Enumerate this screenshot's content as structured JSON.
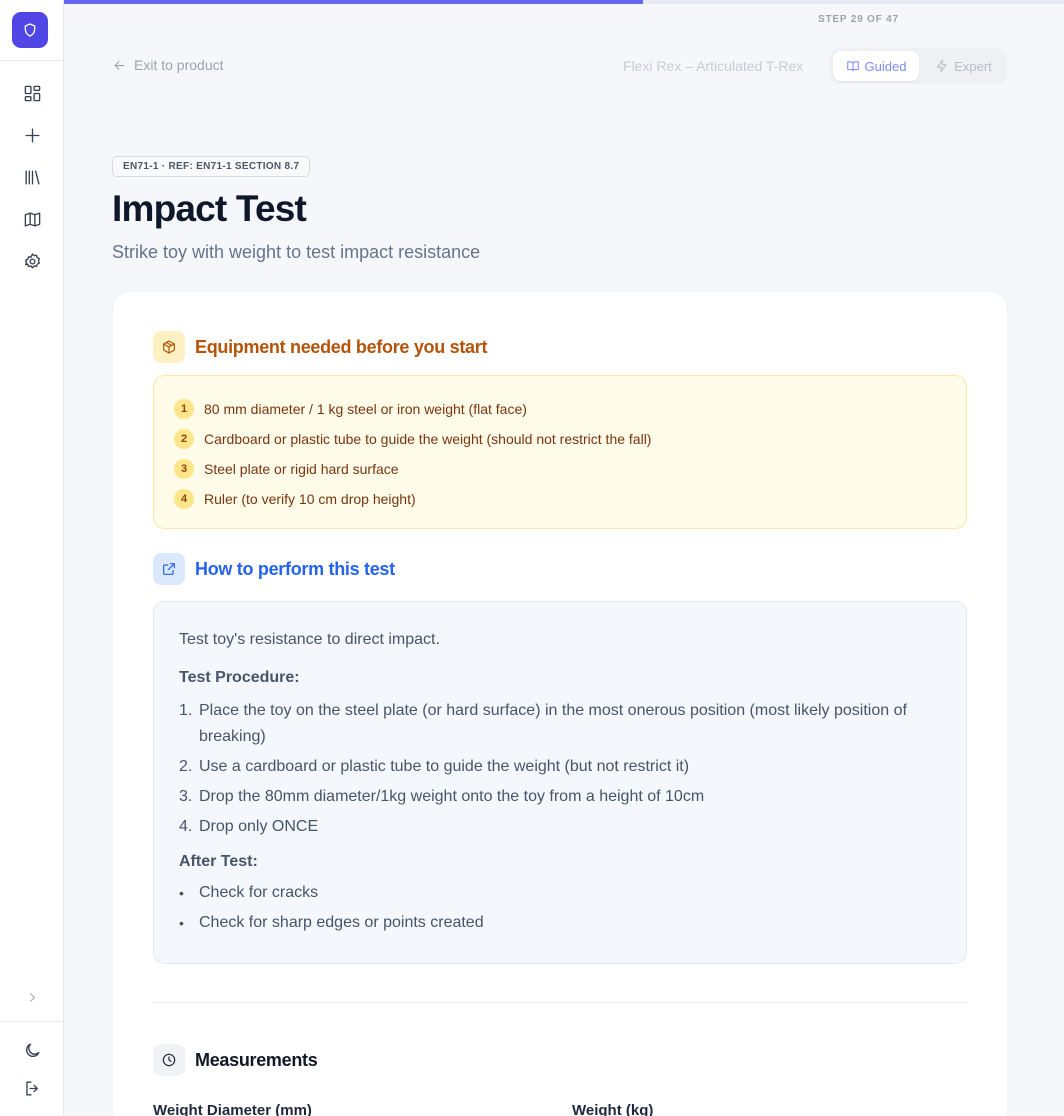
{
  "progress": {
    "current_step": 29,
    "total_steps": 47,
    "fraction": 0.604,
    "step_label": "STEP 29 OF 47",
    "color": "#6366f1"
  },
  "sidebar": {
    "logo_icon": "shield-icon",
    "items": [
      {
        "icon": "dashboard-icon"
      },
      {
        "icon": "plus-icon"
      },
      {
        "icon": "library-icon"
      },
      {
        "icon": "map-icon"
      },
      {
        "icon": "gear-icon"
      }
    ],
    "bottom": [
      {
        "icon": "chevron-right-icon"
      },
      {
        "icon": "moon-icon"
      },
      {
        "icon": "logout-icon"
      }
    ]
  },
  "header": {
    "exit_label": "Exit to product",
    "product_name": "Flexi Rex – Articulated T-Rex",
    "modes": [
      {
        "label": "Guided",
        "icon": "book-icon",
        "active": true
      },
      {
        "label": "Expert",
        "icon": "bolt-icon",
        "active": false
      }
    ]
  },
  "test": {
    "ref_badge": "EN71-1 · REF: EN71-1 SECTION 8.7",
    "title": "Impact Test",
    "subtitle": "Strike toy with weight to test impact resistance"
  },
  "equipment": {
    "title": "Equipment needed before you start",
    "icon": "box-icon",
    "accent": "#b45309",
    "items": [
      {
        "num": "1",
        "text": "80 mm diameter / 1 kg steel or iron weight (flat face)"
      },
      {
        "num": "2",
        "text": "Cardboard or plastic tube to guide the weight (should not restrict the fall)"
      },
      {
        "num": "3",
        "text": "Steel plate or rigid hard surface"
      },
      {
        "num": "4",
        "text": "Ruler (to verify 10 cm drop height)"
      }
    ]
  },
  "how_to": {
    "title": "How to perform this test",
    "icon": "external-link-icon",
    "accent": "#2563eb",
    "intro": "Test toy's resistance to direct impact.",
    "procedure_label": "Test Procedure:",
    "steps": [
      {
        "n": "1.",
        "text": "Place the toy on the steel plate (or hard surface) in the most onerous position (most likely position of breaking)"
      },
      {
        "n": "2.",
        "text": "Use a cardboard or plastic tube to guide the weight (but not restrict it)"
      },
      {
        "n": "3.",
        "text": "Drop the 80mm diameter/1kg weight onto the toy from a height of 10cm"
      },
      {
        "n": "4.",
        "text": "Drop only ONCE"
      }
    ],
    "after_label": "After Test:",
    "after_items": [
      {
        "b": "•",
        "text": "Check for cracks"
      },
      {
        "b": "•",
        "text": "Check for sharp edges or points created"
      }
    ]
  },
  "measurements": {
    "title": "Measurements",
    "icon": "clock-icon",
    "fields": [
      {
        "label": "Weight Diameter (mm)"
      },
      {
        "label": "Weight (kg)"
      }
    ]
  }
}
